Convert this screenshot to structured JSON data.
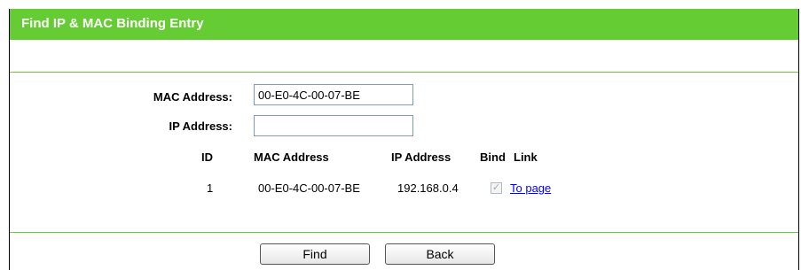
{
  "header": {
    "title": "Find IP & MAC Binding Entry"
  },
  "form": {
    "mac_label": "MAC Address:",
    "mac_value": "00-E0-4C-00-07-BE",
    "ip_label": "IP Address:",
    "ip_value": ""
  },
  "table": {
    "columns": [
      "ID",
      "MAC Address",
      "IP Address",
      "Bind",
      "Link"
    ],
    "rows": [
      {
        "id": "1",
        "mac": "00-E0-4C-00-07-BE",
        "ip": "192.168.0.4",
        "bind_checked": true,
        "link": "To page"
      }
    ]
  },
  "buttons": {
    "find": "Find",
    "back": "Back"
  },
  "colors": {
    "accent": "#66cc33",
    "link": "#0000ff"
  }
}
